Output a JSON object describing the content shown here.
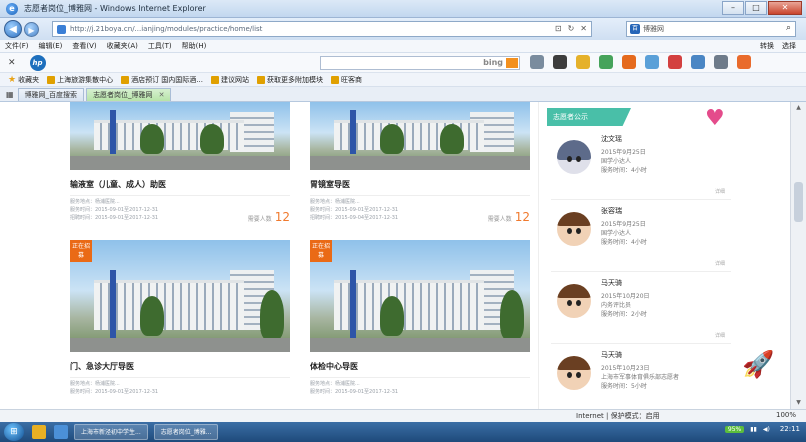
{
  "window": {
    "title": "志愿者岗位_博雅网 - Windows Internet Explorer",
    "btn_min": "–",
    "btn_max": "□",
    "btn_close": "✕"
  },
  "address": {
    "url": "http://j.21boya.cn/...ianjing/modules/practice/home/list",
    "search_label": "博雅网",
    "search_icon": "search-icon"
  },
  "menu": {
    "items": [
      "文件(F)",
      "编辑(E)",
      "查看(V)",
      "收藏夹(A)",
      "工具(T)",
      "帮助(H)"
    ],
    "right": [
      "转换",
      "选择"
    ]
  },
  "hp_toolbar": {
    "logo": "hp",
    "search_engine": "bing"
  },
  "favorites": {
    "label": "收藏夹",
    "items": [
      "上海旅游集散中心",
      "酒店预订 国内国际酒...",
      "建议网站",
      "获取更多附加模块",
      "旺客商"
    ]
  },
  "tabs": [
    {
      "label": "博雅网_百度搜索"
    },
    {
      "label": "志愿者岗位_博雅网"
    }
  ],
  "cards": [
    {
      "title": "输液室（儿童、成人）助医",
      "meta1": "服务地点：杨浦医院...",
      "meta2": "服务时间：2015-09-01至2017-12-31",
      "meta3": "招聘时间：2015-09-01至2017-12-31",
      "count_label": "需要人数",
      "count": "12",
      "badge": ""
    },
    {
      "title": "胃镜室导医",
      "meta1": "服务地点：杨浦医院...",
      "meta2": "服务时间：2015-09-01至2017-12-31",
      "meta3": "招聘时间：2015-09-04至2017-12-31",
      "count_label": "需要人数",
      "count": "12",
      "badge": ""
    },
    {
      "title": "门、急诊大厅导医",
      "meta1": "服务地点：杨浦医院...",
      "meta2": "服务时间：2015-09-01至2017-12-31",
      "meta3": "",
      "count_label": "",
      "count": "",
      "badge": "正在招募"
    },
    {
      "title": "体检中心导医",
      "meta1": "服务地点：杨浦医院...",
      "meta2": "服务时间：2015-09-01至2017-12-31",
      "meta3": "",
      "count_label": "",
      "count": "",
      "badge": "正在招募"
    }
  ],
  "sidebar": {
    "header": "志愿者公示",
    "heart_label": "Volunteer",
    "volunteers": [
      {
        "name": "沈文瑶",
        "date": "2015年9月25日",
        "org": "国学小达人",
        "hours": "服务时间：4小时",
        "detail": "详细"
      },
      {
        "name": "张容瑞",
        "date": "2015年9月25日",
        "org": "国学小达人",
        "hours": "服务时间：4小时",
        "detail": "详细"
      },
      {
        "name": "马天骑",
        "date": "2015年10月20日",
        "org": "内务评比员",
        "hours": "服务时间：2小时",
        "detail": "详细"
      },
      {
        "name": "马天骑",
        "date": "2015年10月23日",
        "org": "上海市军事体育俱乐部志愿者",
        "hours": "服务时间：5小时",
        "detail": ""
      }
    ]
  },
  "status": {
    "zone": "Internet | 保护模式：启用",
    "zoom": "100%"
  },
  "taskbar": {
    "items": [
      "上海市新泾初中学生...",
      "志愿者岗位_博雅..."
    ],
    "battery": "95%",
    "clock": "22:11"
  }
}
